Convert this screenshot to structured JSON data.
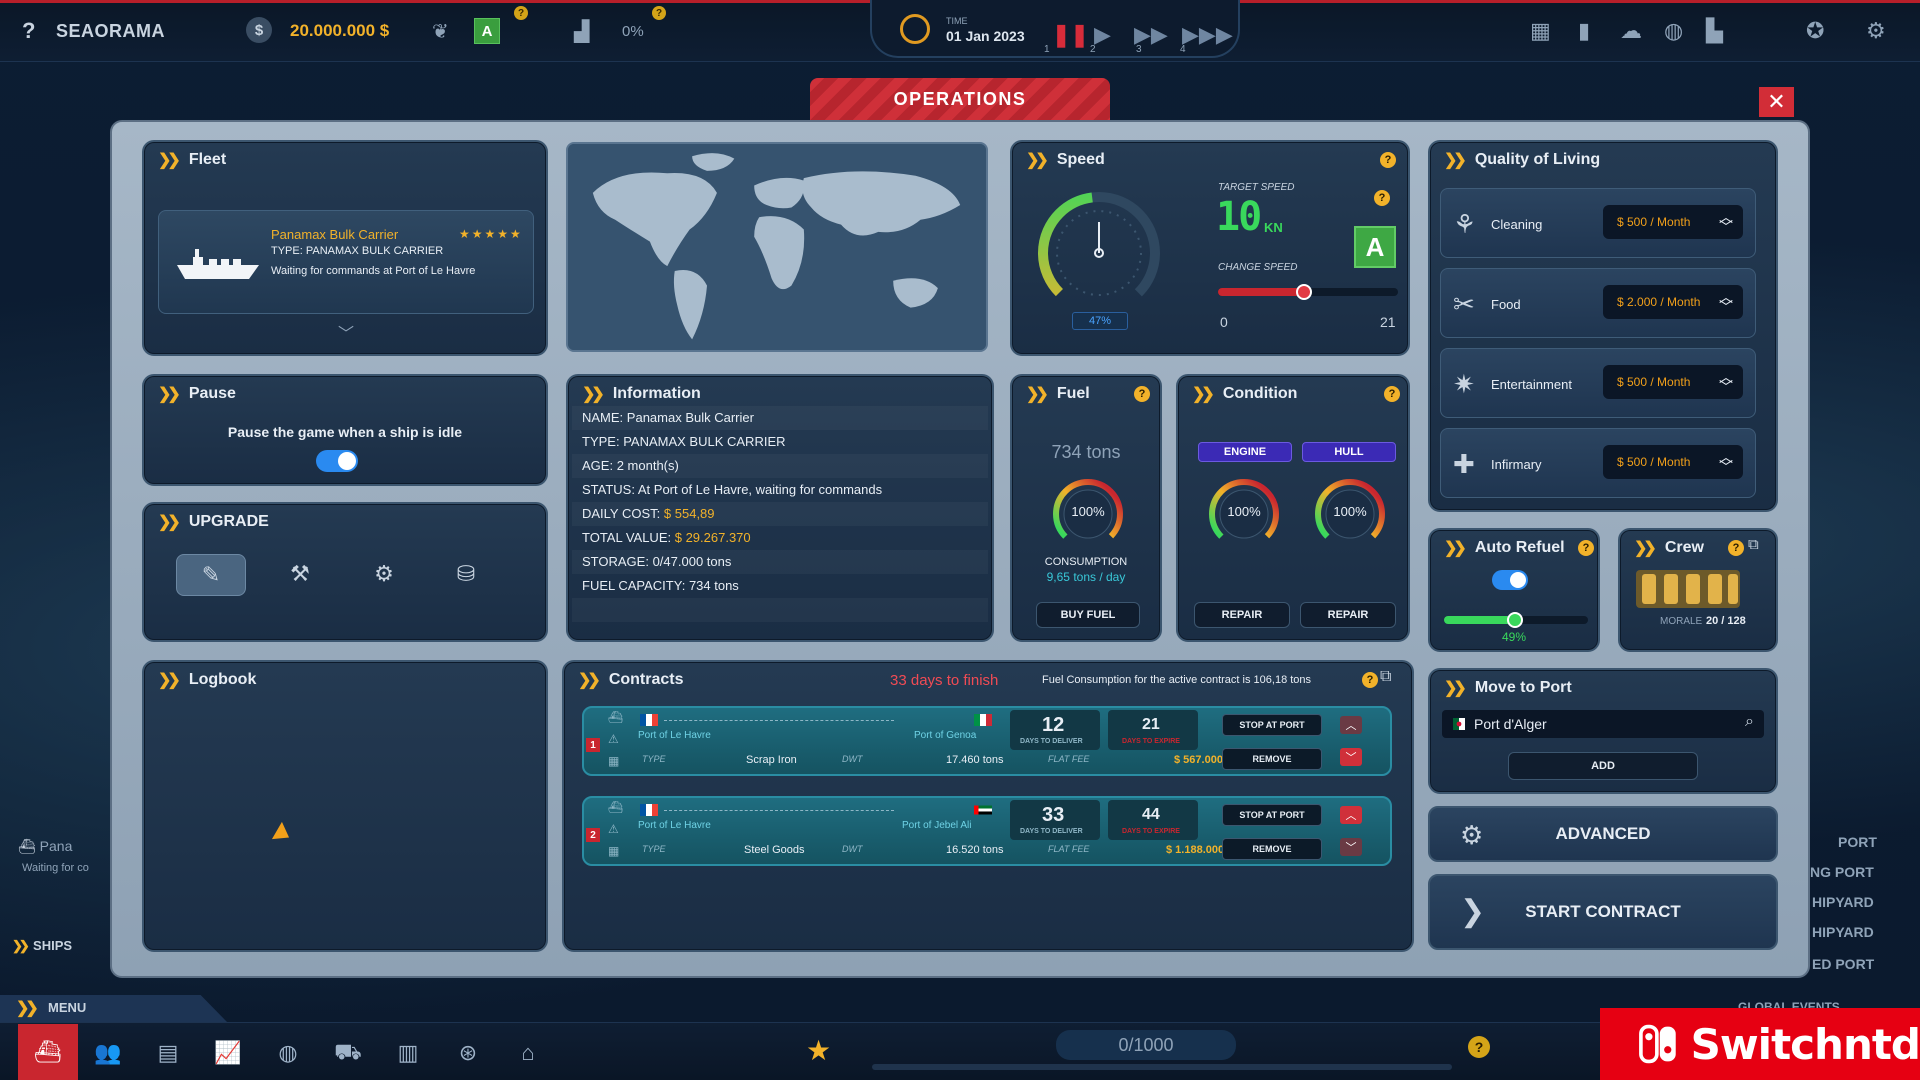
{
  "topbar": {
    "help": "?",
    "company": "SEAORAMA",
    "money_icon": "$",
    "money": "20.000.000 $",
    "rating_badge": "A",
    "percent": "0%",
    "time_label": "TIME",
    "date": "01 Jan 2023",
    "speed_numbers": [
      "1",
      "2",
      "3",
      "4"
    ],
    "icons": [
      "leaf-icon",
      "chart-icon",
      "hourglass-icon",
      "pause-icon",
      "play-icon",
      "fast-forward-icon",
      "fastest-forward-icon",
      "warehouse-icon",
      "phone-icon",
      "weather-icon",
      "globe-icon",
      "building-icon",
      "medal-icon",
      "gear-icon"
    ]
  },
  "modal": {
    "tab_title": "OPERATIONS",
    "close": "✕"
  },
  "fleet": {
    "title": "Fleet",
    "ship_name": "Panamax Bulk Carrier",
    "ship_type": "TYPE: PANAMAX BULK CARRIER",
    "ship_status": "Waiting for commands at Port of Le Havre",
    "stars": "★★★★★",
    "rating": 5
  },
  "pause": {
    "title": "Pause",
    "text": "Pause the game when a ship is idle",
    "enabled": true
  },
  "upgrade": {
    "title": "UPGRADE",
    "buttons": [
      "pencil-icon",
      "tools-icon",
      "gear-icon",
      "paint-bucket-icon"
    ]
  },
  "logbook": {
    "title": "Logbook"
  },
  "speed": {
    "title": "Speed",
    "gauge_percent": "47%",
    "gauge_ticks": [
      "0",
      "100"
    ],
    "target_label": "TARGET SPEED",
    "target_value": "10",
    "target_unit": "KN",
    "change_label": "CHANGE SPEED",
    "badge": "A",
    "slider_min": "0",
    "slider_max": "21",
    "slider_value": 10
  },
  "fuel": {
    "title": "Fuel",
    "amount": "734 tons",
    "gauge": "100%",
    "consumption_label": "CONSUMPTION",
    "consumption_value": "9,65 tons / day",
    "buy_button": "BUY FUEL"
  },
  "condition": {
    "title": "Condition",
    "engine_label": "ENGINE",
    "hull_label": "HULL",
    "engine_gauge": "100%",
    "hull_gauge": "100%",
    "repair_button": "REPAIR"
  },
  "information": {
    "title": "Information",
    "rows": [
      {
        "label": "NAME:",
        "value": "Panamax Bulk Carrier",
        "highlight": false
      },
      {
        "label": "TYPE:",
        "value": "PANAMAX BULK CARRIER",
        "highlight": false
      },
      {
        "label": "AGE:",
        "value": "2 month(s)",
        "highlight": false
      },
      {
        "label": "STATUS:",
        "value": "At Port of Le Havre, waiting for commands",
        "highlight": false
      },
      {
        "label": "DAILY COST:",
        "value": "$ 554,89",
        "highlight": true
      },
      {
        "label": "TOTAL VALUE:",
        "value": "$ 29.267.370",
        "highlight": true
      },
      {
        "label": "STORAGE:",
        "value": "0/47.000 tons",
        "highlight": false
      },
      {
        "label": "FUEL CAPACITY:",
        "value": "734 tons",
        "highlight": false
      }
    ]
  },
  "contracts": {
    "title": "Contracts",
    "days_to_finish": "33 days to finish",
    "fuel_note": "Fuel Consumption for the active contract is 106,18 tons",
    "labels": {
      "type": "TYPE",
      "dwt": "DWT",
      "flat_fee": "FLAT FEE",
      "days_to_deliver": "DAYS TO DELIVER",
      "days_to_expire": "DAYS TO EXPIRE",
      "stop_at_port": "STOP AT PORT",
      "remove": "REMOVE"
    },
    "items": [
      {
        "num": "1",
        "from": "Port of Le Havre",
        "to": "Port of Genoa",
        "days_deliver": "12",
        "days_expire": "21",
        "type": "Scrap Iron",
        "dwt": "17.460 tons",
        "fee": "$ 567.000"
      },
      {
        "num": "2",
        "from": "Port of Le Havre",
        "to": "Port of Jebel Ali",
        "days_deliver": "33",
        "days_expire": "44",
        "type": "Steel Goods",
        "dwt": "16.520 tons",
        "fee": "$ 1.188.000"
      }
    ]
  },
  "quality": {
    "title": "Quality of Living",
    "rows": [
      {
        "name": "Cleaning",
        "value": "$ 500 / Month",
        "icon": "cleaning-icon"
      },
      {
        "name": "Food",
        "value": "$ 2.000 / Month",
        "icon": "food-icon"
      },
      {
        "name": "Entertainment",
        "value": "$ 500 / Month",
        "icon": "party-icon"
      },
      {
        "name": "Infirmary",
        "value": "$ 500 / Month",
        "icon": "medkit-icon"
      }
    ]
  },
  "auto_refuel": {
    "title": "Auto Refuel",
    "enabled": true,
    "percent": "49%"
  },
  "crew": {
    "title": "Crew",
    "label": "MORALE",
    "count": "20 / 128"
  },
  "move_to_port": {
    "title": "Move to Port",
    "port": "Port d'Alger",
    "add_button": "ADD"
  },
  "advanced_button": "ADVANCED",
  "start_button": "START CONTRACT",
  "background": {
    "ships_label": "SHIPS",
    "ship_partial": "Pana",
    "ship_partial_status": "Waiting for co",
    "side_labels": [
      "PORT",
      "NG PORT",
      "HIPYARD",
      "HIPYARD",
      "ED PORT"
    ],
    "global_events": "GLOBAL EVENTS"
  },
  "bottom": {
    "menu": "MENU",
    "progress": "0/1000",
    "icons": [
      "ship-icon",
      "people-icon",
      "document-icon",
      "chart-icon",
      "globe-icon",
      "motorbike-icon",
      "buildings-icon",
      "world-gear-icon",
      "bank-icon"
    ]
  },
  "watermark": "Switchntd",
  "colors": {
    "accent": "#f2b22a",
    "red": "#c9262f",
    "green": "#39d85c",
    "panel": "#1a2d44"
  }
}
